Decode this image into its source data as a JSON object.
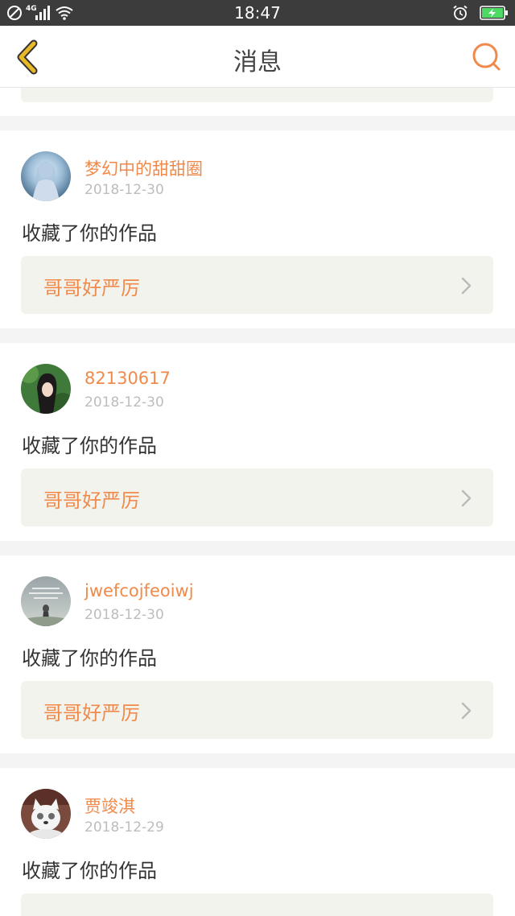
{
  "status_bar": {
    "time": "18:47",
    "network_label": "4G",
    "icons": [
      "do-not-disturb-icon",
      "signal-icon",
      "wifi-icon",
      "alarm-icon",
      "battery-charging-icon"
    ]
  },
  "header": {
    "title": "消息",
    "back_icon": "chevron-left-icon",
    "search_icon": "search-icon"
  },
  "messages": [
    {
      "username": "梦幻中的甜甜圈",
      "date": "2018-12-30",
      "action": "收藏了你的作品",
      "work_title": "哥哥好严厉"
    },
    {
      "username": "82130617",
      "date": "2018-12-30",
      "action": "收藏了你的作品",
      "work_title": "哥哥好严厉"
    },
    {
      "username": "jwefcojfeoiwj",
      "date": "2018-12-30",
      "action": "收藏了你的作品",
      "work_title": "哥哥好严厉"
    },
    {
      "username": "贾竣淇",
      "date": "2018-12-29",
      "action": "收藏了你的作品",
      "work_title": ""
    }
  ],
  "colors": {
    "accent": "#f08a4b",
    "back_icon": "#e8b826",
    "card_bg": "#f3f3ee",
    "status_bar": "#3c3c3c"
  }
}
